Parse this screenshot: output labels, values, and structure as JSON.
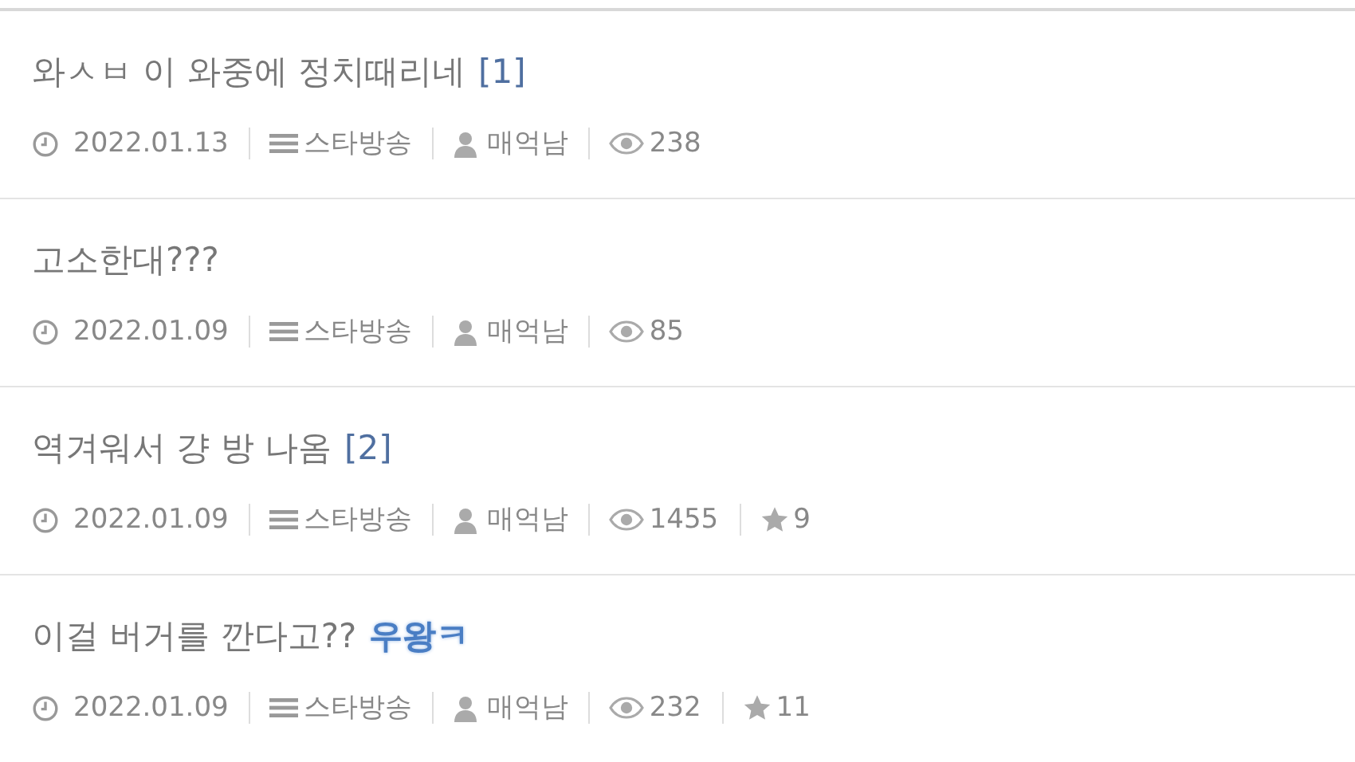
{
  "posts": [
    {
      "title": "와ㅅㅂ 이 와중에 정치때리네",
      "comment_count": "[1]",
      "date": "2022.01.13",
      "category": "스타방송",
      "author": "매억남",
      "views": "238"
    },
    {
      "title": "고소한대???",
      "date": "2022.01.09",
      "category": "스타방송",
      "author": "매억남",
      "views": "85"
    },
    {
      "title": "역겨워서 걍 방 나옴",
      "comment_count": "[2]",
      "date": "2022.01.09",
      "category": "스타방송",
      "author": "매억남",
      "views": "1455",
      "recommends": "9"
    },
    {
      "title": "이걸 버거를 깐다고??",
      "emphasis": "우왕ㅋ",
      "date": "2022.01.09",
      "category": "스타방송",
      "author": "매억남",
      "views": "232",
      "recommends": "11"
    }
  ]
}
